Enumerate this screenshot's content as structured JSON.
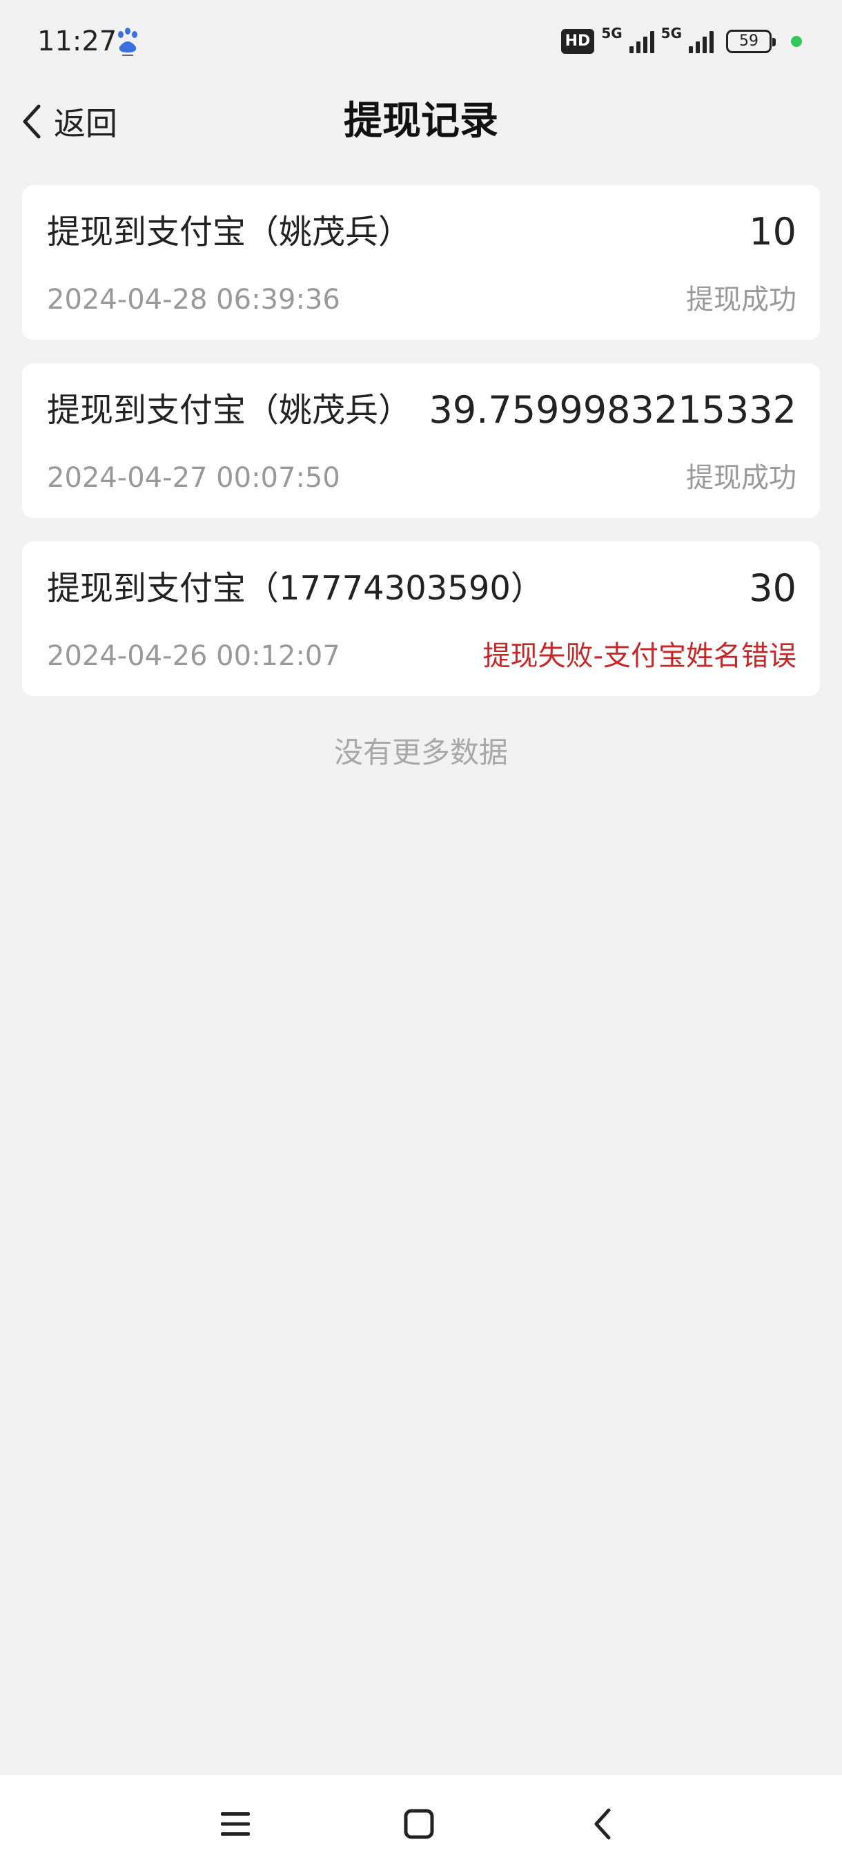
{
  "status_bar": {
    "time": "11:27",
    "hd": "HD",
    "network_1": "5G",
    "network_2": "5G",
    "battery": "59"
  },
  "header": {
    "back_label": "返回",
    "title": "提现记录"
  },
  "records": [
    {
      "title": "提现到支付宝（姚茂兵）",
      "amount": "10",
      "time": "2024-04-28 06:39:36",
      "status": "提现成功"
    },
    {
      "title": "提现到支付宝（姚茂兵）",
      "amount": "39.7599983215332",
      "time": "2024-04-27 00:07:50",
      "status": "提现成功"
    },
    {
      "title": "提现到支付宝（17774303590）",
      "amount": "30",
      "time": "2024-04-26 00:12:07",
      "status": "提现失败-支付宝姓名错误"
    }
  ],
  "no_more_text": "没有更多数据",
  "colors": {
    "background": "#f2f2f2",
    "card": "#ffffff",
    "muted_text": "#999999",
    "error_text": "#c62828",
    "status_dot": "#34c759"
  },
  "icons": {
    "back": "chevron-left-icon",
    "baidu": "baidu-paw-icon",
    "nav_menu": "menu-icon",
    "nav_home": "home-square-icon",
    "nav_back": "back-arrow-icon"
  }
}
